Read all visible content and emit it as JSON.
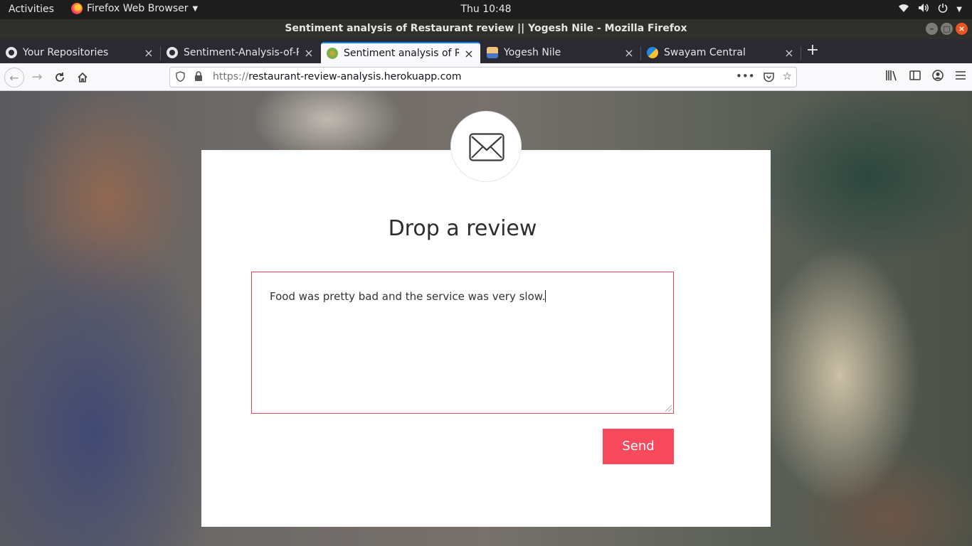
{
  "topbar": {
    "activities": "Activities",
    "app_name": "Firefox Web Browser",
    "clock": "Thu 10:48"
  },
  "window": {
    "title": "Sentiment analysis of Restaurant review || Yogesh Nile - Mozilla Firefox"
  },
  "tabs": [
    {
      "label": "Your Repositories",
      "icon": "github-icon",
      "active": false
    },
    {
      "label": "Sentiment-Analysis-of-Re",
      "icon": "github-icon",
      "active": false
    },
    {
      "label": "Sentiment analysis of Re",
      "icon": "site-favicon",
      "active": true
    },
    {
      "label": "Yogesh Nile",
      "icon": "user-avatar-icon",
      "active": false
    },
    {
      "label": "Swayam Central",
      "icon": "swayam-icon",
      "active": false
    }
  ],
  "navbar": {
    "url_prefix": "https://",
    "url_host": "restaurant-review-analysis.herokuapp.com"
  },
  "page": {
    "heading": "Drop a review",
    "review_text": "Food was pretty bad and the service was very slow.",
    "send_label": "Send"
  },
  "colors": {
    "accent": "#f84a5d",
    "active_tab_border": "#0a84ff",
    "close_button": "#e95420"
  }
}
